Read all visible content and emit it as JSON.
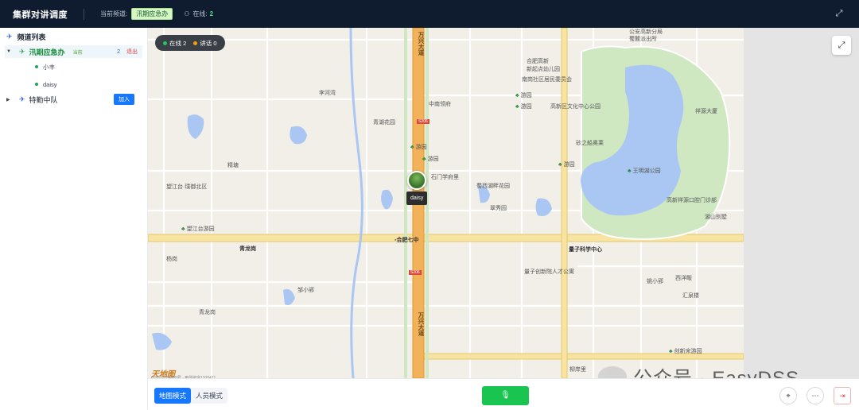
{
  "topbar": {
    "title": "集群对讲调度",
    "current_channel_label": "当前频道:",
    "current_channel": "汛期应急办",
    "online_label": "在线:",
    "online_count": "2",
    "fullscreen_icon": "fullscreen-icon"
  },
  "sidebar": {
    "header": "频道列表",
    "channels": [
      {
        "name": "汛期应急办",
        "tag": "当前",
        "count": "2",
        "action": "退出",
        "expanded": true,
        "members": [
          "小丰",
          "daisy"
        ]
      },
      {
        "name": "特勤中队",
        "action": "加入",
        "expanded": false
      }
    ]
  },
  "map": {
    "status": {
      "online_label": "在线",
      "online_count": "2",
      "talking_label": "讲话",
      "talking_count": "0",
      "online_color": "#22c55e",
      "talking_color": "#f59e0b"
    },
    "marker": {
      "label": "daisy"
    },
    "labels": {
      "wanxing_road_top": "万兴大道",
      "wanxing_road_bottom": "万兴大道",
      "hefei_7": "合肥七中",
      "zhongnan": "中南领府",
      "lihepu": "李河湾",
      "qinghu": "青湖花园",
      "youyuan1": "游园",
      "youyuan2": "游园",
      "youyuan3": "游园",
      "youyuan4": "游园",
      "youyuan5": "游园",
      "jingtang": "精塘",
      "wangjiang_bay": "望江台·璞御北区",
      "wangjiang_park": "望江台游园",
      "shimen": "石门学府里",
      "shuxi": "蜀西湖畔花园",
      "cuixiu": "翠秀园",
      "qinglong": "青龙岗",
      "yangao": "杨岗",
      "zouxiaowei": "邹小郢",
      "qinglong_wei": "青龙岗",
      "quantum": "量子科学中心",
      "quantum_industry": "量子创新院人才公寓",
      "kindergarten_1": "合肥高新",
      "kindergarten_2": "新起点幼儿园",
      "nangang": "南岗社区居民委员会",
      "culture": "高新区文化中心公园",
      "shazhi": "砂之船奥莱",
      "wangjiang_west": "王明湖公园",
      "gaoxin_hospital": "高新祥源口腔门诊部",
      "police_1": "公安高新分局",
      "police_2": "蜀麓派出所",
      "xiangyuan": "祥源大厦",
      "hushan": "湖山别墅",
      "xisong": "西洋畈",
      "huixiang": "汇泉楼",
      "yaoxiao": "姚小郢",
      "chuangxin": "创新宋游园",
      "liuan": "柳岸里",
      "road_s206a": "S206",
      "road_s206b": "S206"
    },
    "map_logo": "天地图",
    "copyright": "GS(2023)4609号 - 甲测资字1100471",
    "fullscreen_icon": "fullscreen-icon"
  },
  "bottombar": {
    "modes": [
      "地图模式",
      "人员模式"
    ],
    "active_mode": 0,
    "talk_icon": "microphone-icon",
    "locate_icon": "locate-icon",
    "chat_icon": "chat-icon",
    "exit_icon": "exit-icon"
  },
  "watermark": {
    "text": "公众号 · EasyDSS"
  }
}
